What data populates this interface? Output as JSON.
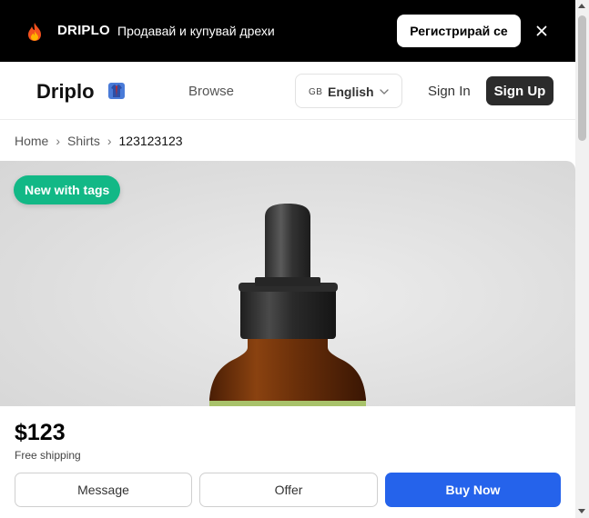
{
  "promo": {
    "brand": "DRIPLO",
    "tagline": "Продавай и купувай дрехи",
    "register_label": "Регистрирай се",
    "icons": {
      "flame": "flame-icon",
      "close": "close-icon"
    }
  },
  "header": {
    "logo_text": "Driplo",
    "logo_icon": "shirt-icon",
    "nav_browse": "Browse",
    "language": {
      "code": "GB",
      "label": "English"
    },
    "signin_label": "Sign In",
    "signup_label": "Sign Up"
  },
  "breadcrumb": [
    "Home",
    "Shirts",
    "123123123"
  ],
  "breadcrumb_separator": "›",
  "product": {
    "condition_badge": "New with tags",
    "price": "$123",
    "shipping": "Free shipping"
  },
  "actions": {
    "message_label": "Message",
    "offer_label": "Offer",
    "buy_label": "Buy Now"
  },
  "colors": {
    "promo_bg": "#000000",
    "badge_green": "#12b886",
    "buy_blue": "#2563eb",
    "signup_dark": "#2b2b2b"
  }
}
